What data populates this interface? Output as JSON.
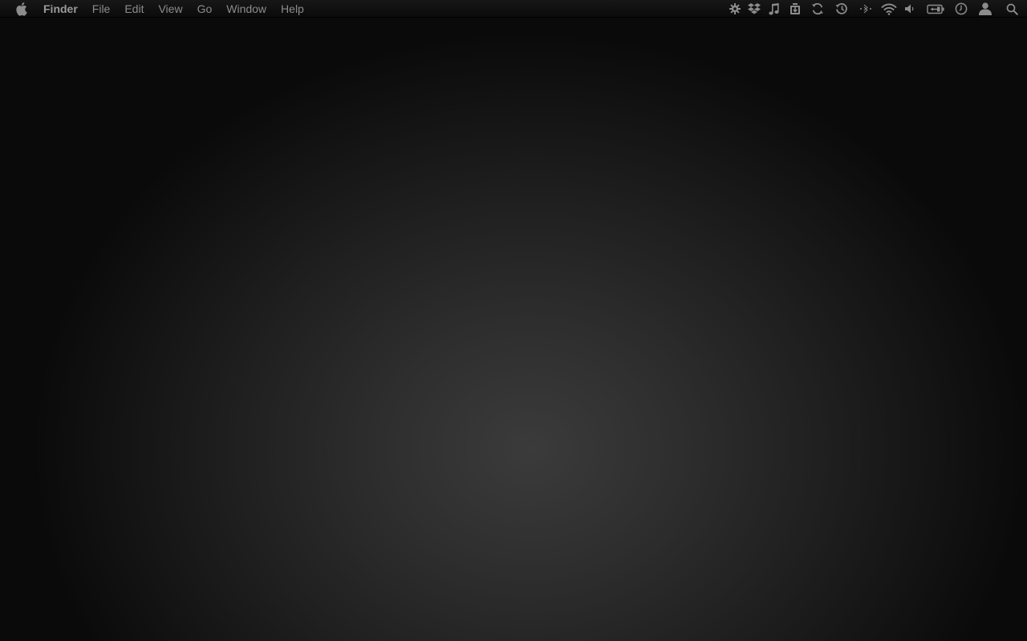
{
  "menubar": {
    "apple_icon": "apple-logo-icon",
    "app_name": "Finder",
    "items": [
      {
        "label": "File"
      },
      {
        "label": "Edit"
      },
      {
        "label": "View"
      },
      {
        "label": "Go"
      },
      {
        "label": "Window"
      },
      {
        "label": "Help"
      }
    ],
    "status_icons": [
      "gear-icon",
      "dropbox-icon",
      "music-note-icon",
      "download-box-icon",
      "sync-icon",
      "time-machine-icon",
      "bluetooth-icon",
      "wifi-icon",
      "volume-icon",
      "battery-icon",
      "clock-icon",
      "user-icon",
      "spotlight-search-icon"
    ]
  },
  "colors": {
    "menubar_background": "#111111",
    "menu_text": "#8c8c8c",
    "desktop_center": "#3b3b3b",
    "desktop_edge": "#0a0a0a"
  }
}
